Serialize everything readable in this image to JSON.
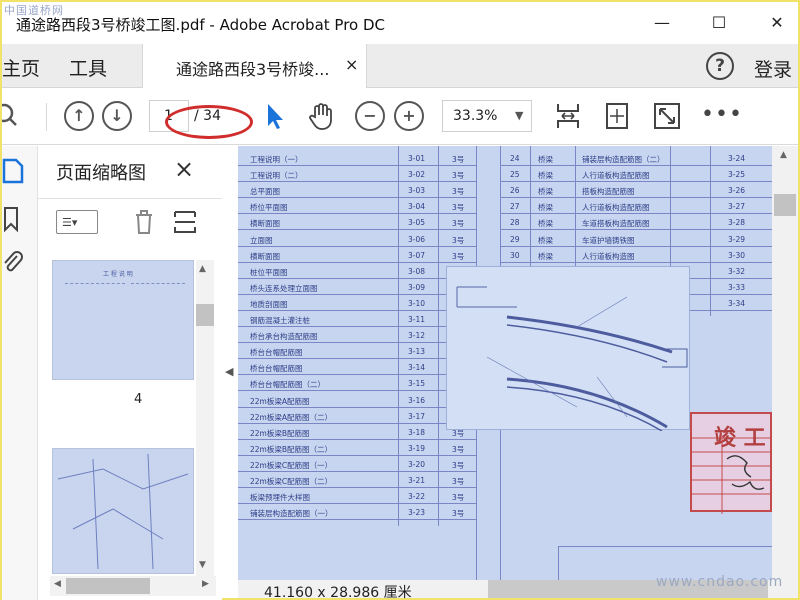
{
  "titlebar": {
    "title": "通途路西段3号桥竣工图.pdf - Adobe Acrobat Pro DC",
    "corner_watermark": "中国道桥网",
    "minimize": "—",
    "maximize": "☐",
    "close": "✕"
  },
  "tabs": {
    "home": "主页",
    "tools": "工具",
    "document": "通途路西段3号桥竣...",
    "document_close": "×",
    "help": "?",
    "login": "登录"
  },
  "toolbar": {
    "page_current": "1",
    "page_total": "/ 34",
    "zoom": "33.3%"
  },
  "thumbnails": {
    "panel_title": "页面缩略图",
    "close": "×",
    "page_label": "4"
  },
  "status": {
    "dimensions": "41.160 x 28.986 厘米",
    "watermark": "www.cndao.com"
  },
  "document": {
    "left_rows": [
      {
        "name": "工程说明（一）",
        "no": "3-01",
        "sheet": "3号"
      },
      {
        "name": "工程说明（二）",
        "no": "3-02",
        "sheet": "3号"
      },
      {
        "name": "总平面图",
        "no": "3-03",
        "sheet": "3号"
      },
      {
        "name": "桥位平面图",
        "no": "3-04",
        "sheet": "3号"
      },
      {
        "name": "横断面图",
        "no": "3-05",
        "sheet": "3号"
      },
      {
        "name": "立面图",
        "no": "3-06",
        "sheet": "3号"
      },
      {
        "name": "横断面图",
        "no": "3-07",
        "sheet": "3号"
      },
      {
        "name": "桩位平面图",
        "no": "3-08",
        "sheet": "3号"
      },
      {
        "name": "桥头连系处理立面图",
        "no": "3-09",
        "sheet": "3号"
      },
      {
        "name": "地质剖面图",
        "no": "3-10",
        "sheet": "3号"
      },
      {
        "name": "钢筋混凝土灌注桩",
        "no": "3-11",
        "sheet": "3号"
      },
      {
        "name": "桥台承台构造配筋图",
        "no": "3-12",
        "sheet": "3号"
      },
      {
        "name": "桥台台帽配筋图",
        "no": "3-13",
        "sheet": "3号"
      },
      {
        "name": "桥台台帽配筋图",
        "no": "3-14",
        "sheet": "3号"
      },
      {
        "name": "桥台台帽配筋图（二）",
        "no": "3-15",
        "sheet": "3号"
      },
      {
        "name": "22m板梁A配筋图",
        "no": "3-16",
        "sheet": "3号"
      },
      {
        "name": "22m板梁A配筋图（二）",
        "no": "3-17",
        "sheet": "3号"
      },
      {
        "name": "22m板梁B配筋图",
        "no": "3-18",
        "sheet": "3号"
      },
      {
        "name": "22m板梁B配筋图（二）",
        "no": "3-19",
        "sheet": "3号"
      },
      {
        "name": "22m板梁C配筋图（一）",
        "no": "3-20",
        "sheet": "3号"
      },
      {
        "name": "22m板梁C配筋图（二）",
        "no": "3-21",
        "sheet": "3号"
      },
      {
        "name": "板梁预埋件大样图",
        "no": "3-22",
        "sheet": "3号"
      },
      {
        "name": "铺装层构造配筋图（一）",
        "no": "3-23",
        "sheet": "3号"
      }
    ],
    "right_rows": [
      {
        "idx": "24",
        "part": "桥梁",
        "name": "铺装层构造配筋图（二）",
        "no": "3-24"
      },
      {
        "idx": "25",
        "part": "桥梁",
        "name": "人行道板构造配筋图",
        "no": "3-25"
      },
      {
        "idx": "26",
        "part": "桥梁",
        "name": "搭板构造配筋图",
        "no": "3-26"
      },
      {
        "idx": "27",
        "part": "桥梁",
        "name": "人行道板构造配筋图",
        "no": "3-27"
      },
      {
        "idx": "28",
        "part": "桥梁",
        "name": "车道搭板构造配筋图",
        "no": "3-28"
      },
      {
        "idx": "29",
        "part": "桥梁",
        "name": "车道护墙铸铁图",
        "no": "3-29"
      },
      {
        "idx": "30",
        "part": "桥梁",
        "name": "人行道板构造图",
        "no": "3-30"
      },
      {
        "idx": "",
        "part": "",
        "name": "",
        "no": "3-32"
      },
      {
        "idx": "",
        "part": "",
        "name": "",
        "no": "3-33"
      },
      {
        "idx": "",
        "part": "",
        "name": "",
        "no": "3-34"
      }
    ],
    "stamp_text": "竣 工"
  }
}
